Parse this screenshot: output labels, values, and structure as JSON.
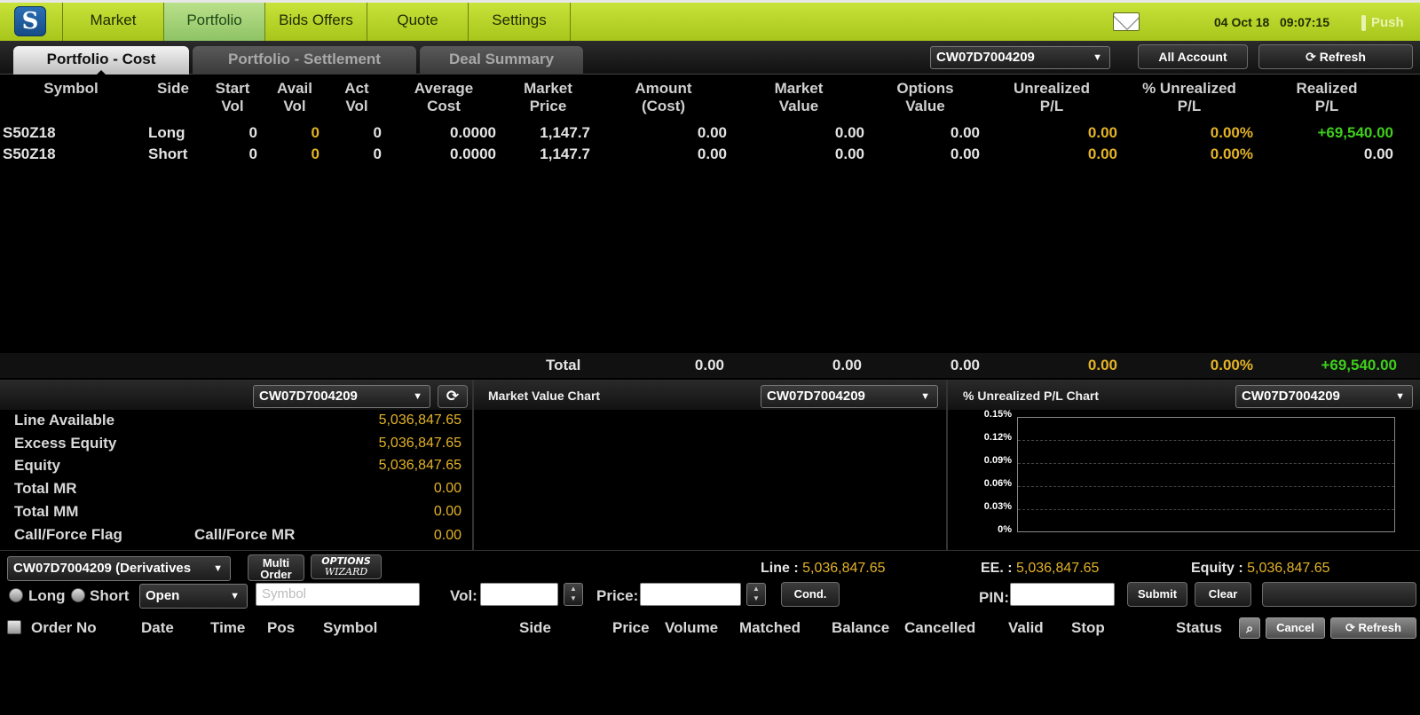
{
  "topbar": {
    "logo": "S",
    "tabs": [
      "Market",
      "Portfolio",
      "Bids Offers",
      "Quote",
      "Settings"
    ],
    "active_tab": "Portfolio",
    "date": "04 Oct 18",
    "time": "09:07:15",
    "push": "Push"
  },
  "subtabs": [
    "Portfolio - Cost",
    "Portfolio - Settlement",
    "Deal Summary"
  ],
  "account_select": "CW07D7004209",
  "buttons": {
    "all_account": "All Account",
    "refresh": "Refresh"
  },
  "table": {
    "headers": [
      [
        "Symbol",
        ""
      ],
      [
        "Side",
        ""
      ],
      [
        "Start",
        "Vol"
      ],
      [
        "Avail",
        "Vol"
      ],
      [
        "Act",
        "Vol"
      ],
      [
        "Average",
        "Cost"
      ],
      [
        "Market",
        "Price"
      ],
      [
        "Amount",
        "(Cost)"
      ],
      [
        "Market",
        "Value"
      ],
      [
        "Options",
        "Value"
      ],
      [
        "Unrealized",
        "P/L"
      ],
      [
        "% Unrealized",
        "P/L"
      ],
      [
        "Realized",
        "P/L"
      ]
    ],
    "rows": [
      {
        "symbol": "S50Z18",
        "side": "Long",
        "start_vol": "0",
        "avail_vol": "0",
        "act_vol": "0",
        "avg_cost": "0.0000",
        "mkt_price": "1,147.7",
        "amount": "0.00",
        "mkt_value": "0.00",
        "opt_value": "0.00",
        "unreal": "0.00",
        "pct_unreal": "0.00%",
        "realized": "+69,540.00"
      },
      {
        "symbol": "S50Z18",
        "side": "Short",
        "start_vol": "0",
        "avail_vol": "0",
        "act_vol": "0",
        "avg_cost": "0.0000",
        "mkt_price": "1,147.7",
        "amount": "0.00",
        "mkt_value": "0.00",
        "opt_value": "0.00",
        "unreal": "0.00",
        "pct_unreal": "0.00%",
        "realized": "0.00"
      }
    ],
    "total": {
      "label": "Total",
      "amount": "0.00",
      "mkt_value": "0.00",
      "opt_value": "0.00",
      "unreal": "0.00",
      "pct_unreal": "0.00%",
      "realized": "+69,540.00"
    }
  },
  "summary": {
    "account": "CW07D7004209",
    "items": [
      {
        "label": "Line Available",
        "value": "5,036,847.65"
      },
      {
        "label": "Excess Equity",
        "value": "5,036,847.65"
      },
      {
        "label": "Equity",
        "value": "5,036,847.65"
      },
      {
        "label": "Total MR",
        "value": "0.00"
      },
      {
        "label": "Total MM",
        "value": "0.00"
      }
    ],
    "flag_label": "Call/Force Flag",
    "flag_mr_label": "Call/Force MR",
    "flag_mr_value": "0.00"
  },
  "mv_chart": {
    "title": "Market Value Chart",
    "account": "CW07D7004209"
  },
  "pl_chart": {
    "title": "% Unrealized P/L Chart",
    "account": "CW07D7004209"
  },
  "chart_data": {
    "type": "line",
    "title": "% Unrealized P/L Chart",
    "y_ticks": [
      "0.15%",
      "0.12%",
      "0.09%",
      "0.06%",
      "0.03%",
      "0%"
    ],
    "ylim": [
      0,
      0.15
    ],
    "grid": true,
    "series": []
  },
  "order_entry": {
    "account": "CW07D7004209 (Derivatives",
    "multi_order": [
      "Multi",
      "Order"
    ],
    "options_wizard": [
      "OPTIONS",
      "WIZARD"
    ],
    "line_label": "Line :",
    "line_value": "5,036,847.65",
    "ee_label": "EE. :",
    "ee_value": "5,036,847.65",
    "equity_label": "Equity :",
    "equity_value": "5,036,847.65",
    "long": "Long",
    "short": "Short",
    "position": "Open",
    "symbol_placeholder": "Symbol",
    "vol_label": "Vol:",
    "price_label": "Price:",
    "cond": "Cond.",
    "pin_label": "PIN:",
    "submit": "Submit",
    "clear": "Clear"
  },
  "orders": {
    "headers": [
      "Order No",
      "Date",
      "Time",
      "Pos",
      "Symbol",
      "Side",
      "Price",
      "Volume",
      "Matched",
      "Balance",
      "Cancelled",
      "Valid",
      "Stop",
      "Status"
    ],
    "cancel": "Cancel",
    "refresh": "Refresh"
  }
}
